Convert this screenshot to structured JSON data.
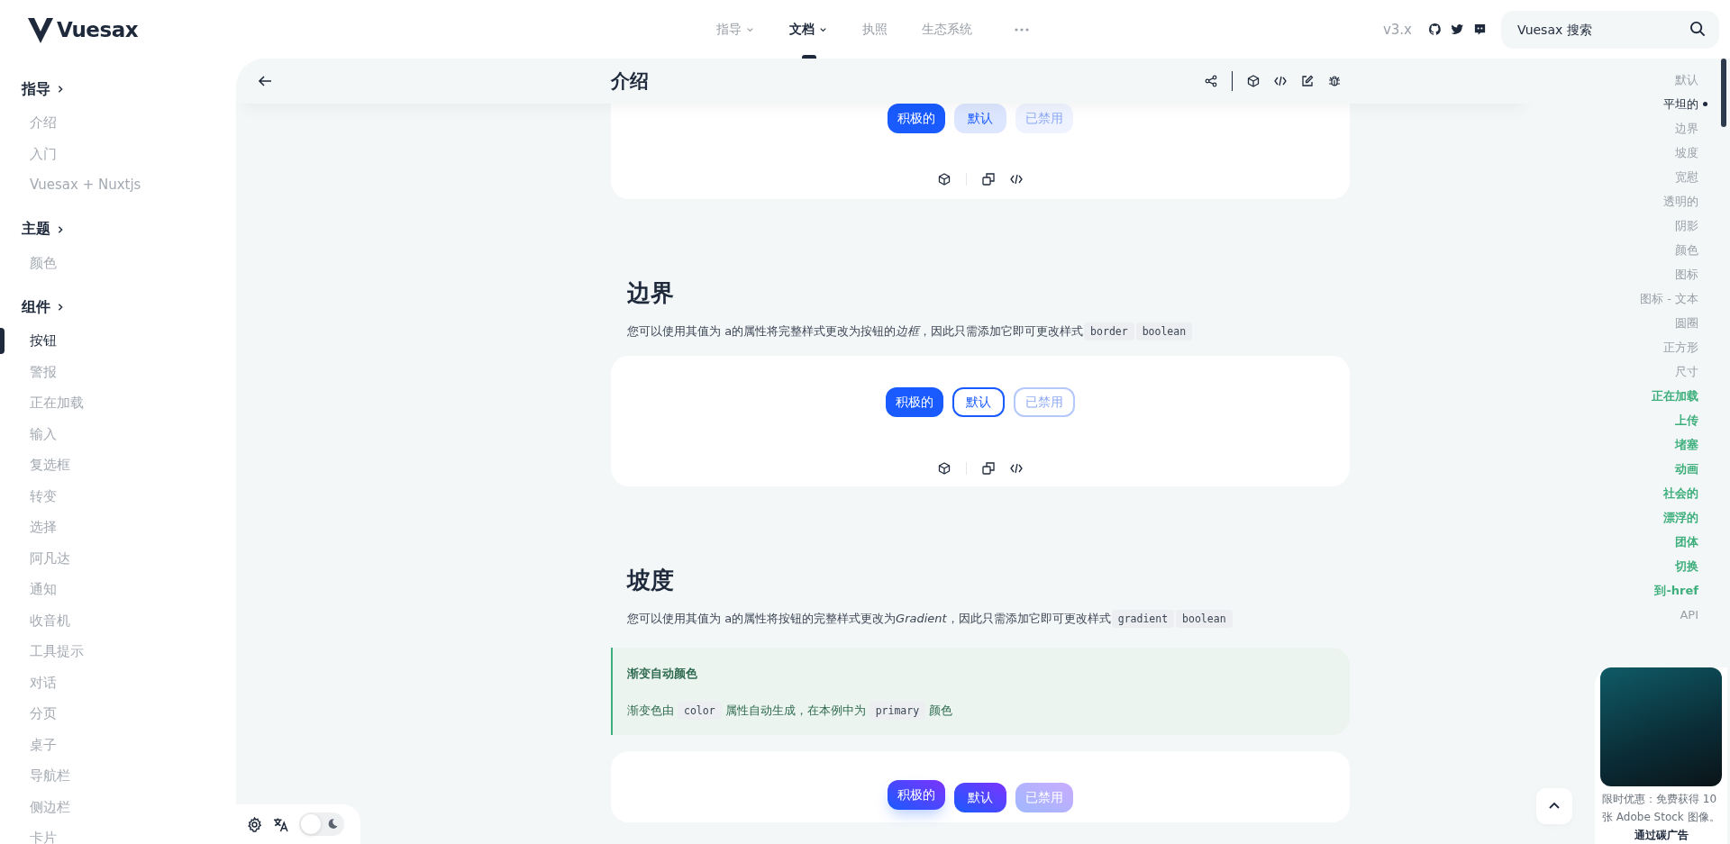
{
  "header": {
    "logo": "Vuesax",
    "nav": [
      {
        "label": "指导",
        "dropdown": true,
        "selected": false
      },
      {
        "label": "文档",
        "dropdown": true,
        "selected": true
      },
      {
        "label": "执照",
        "dropdown": false,
        "selected": false
      },
      {
        "label": "生态系统",
        "dropdown": false,
        "selected": false
      }
    ],
    "version": "v3.x",
    "search": {
      "placeholder": "Vuesax 搜索"
    }
  },
  "sidebar": {
    "sections": [
      {
        "title": "指导",
        "items": [
          {
            "label": "介绍",
            "selected": false
          },
          {
            "label": "入门",
            "selected": false
          },
          {
            "label": "Vuesax + Nuxtjs",
            "selected": false
          }
        ]
      },
      {
        "title": "主题",
        "items": [
          {
            "label": "颜色",
            "selected": false
          }
        ]
      },
      {
        "title": "组件",
        "items": [
          {
            "label": "按钮",
            "selected": true
          },
          {
            "label": "警报",
            "selected": false
          },
          {
            "label": "正在加载",
            "selected": false
          },
          {
            "label": "输入",
            "selected": false
          },
          {
            "label": "复选框",
            "selected": false
          },
          {
            "label": "转变",
            "selected": false
          },
          {
            "label": "选择",
            "selected": false
          },
          {
            "label": "阿凡达",
            "selected": false
          },
          {
            "label": "通知",
            "selected": false
          },
          {
            "label": "收音机",
            "selected": false
          },
          {
            "label": "工具提示",
            "selected": false
          },
          {
            "label": "对话",
            "selected": false
          },
          {
            "label": "分页",
            "selected": false
          },
          {
            "label": "桌子",
            "selected": false
          },
          {
            "label": "导航栏",
            "selected": false
          },
          {
            "label": "侧边栏",
            "selected": false
          },
          {
            "label": "卡片",
            "selected": false
          }
        ]
      }
    ]
  },
  "page": {
    "title": "介绍",
    "sections": [
      {
        "demo": {
          "kind": "flat",
          "toolbar": true,
          "buttons": [
            {
              "label": "积极的",
              "active": true,
              "disabled": false
            },
            {
              "label": "默认",
              "active": false,
              "disabled": false
            },
            {
              "label": "已禁用",
              "active": false,
              "disabled": true
            }
          ]
        }
      },
      {
        "heading": "边界",
        "description": [
          {
            "kind": "text",
            "text": "您可以使用其值为 a的属性将完整样式更改为按钮的"
          },
          {
            "kind": "em",
            "text": "边框"
          },
          {
            "kind": "text",
            "text": "，因此只需添加它即可更改样式"
          },
          {
            "kind": "code",
            "text": "border"
          },
          {
            "kind": "code",
            "text": "boolean"
          }
        ],
        "demo": {
          "kind": "border",
          "toolbar": true,
          "buttons": [
            {
              "label": "积极的",
              "active": true,
              "disabled": false
            },
            {
              "label": "默认",
              "active": false,
              "disabled": false
            },
            {
              "label": "已禁用",
              "active": false,
              "disabled": true
            }
          ]
        }
      },
      {
        "heading": "坡度",
        "description": [
          {
            "kind": "text",
            "text": "您可以使用其值为 a的属性将按钮的完整样式更改为"
          },
          {
            "kind": "em",
            "text": "Gradient"
          },
          {
            "kind": "text",
            "text": "，因此只需添加它即可更改样式"
          },
          {
            "kind": "code",
            "text": "gradient"
          },
          {
            "kind": "code",
            "text": "boolean"
          }
        ],
        "note": {
          "title": "渐变自动颜色",
          "text": [
            {
              "kind": "text",
              "text": "渐变色由"
            },
            {
              "kind": "code",
              "text": "color"
            },
            {
              "kind": "text",
              "text": "属性自动生成，在本例中为"
            },
            {
              "kind": "code",
              "text": "primary"
            },
            {
              "kind": "text",
              "text": "颜色"
            }
          ]
        },
        "demo": {
          "kind": "gradient",
          "toolbar": false,
          "buttons": [
            {
              "label": "积极的",
              "active": true,
              "disabled": false
            },
            {
              "label": "默认",
              "active": false,
              "disabled": false
            },
            {
              "label": "已禁用",
              "active": false,
              "disabled": true
            }
          ]
        }
      }
    ]
  },
  "toc": {
    "items": [
      {
        "label": "默认",
        "selected": false,
        "kind": "normal"
      },
      {
        "label": "平坦的",
        "selected": true,
        "kind": "normal"
      },
      {
        "label": "边界",
        "selected": false,
        "kind": "normal"
      },
      {
        "label": "坡度",
        "selected": false,
        "kind": "normal"
      },
      {
        "label": "宽慰",
        "selected": false,
        "kind": "normal"
      },
      {
        "label": "透明的",
        "selected": false,
        "kind": "normal"
      },
      {
        "label": "阴影",
        "selected": false,
        "kind": "normal"
      },
      {
        "label": "颜色",
        "selected": false,
        "kind": "normal"
      },
      {
        "label": "图标",
        "selected": false,
        "kind": "normal"
      },
      {
        "label": "图标 - 文本",
        "selected": false,
        "kind": "normal"
      },
      {
        "label": "圆圈",
        "selected": false,
        "kind": "normal"
      },
      {
        "label": "正方形",
        "selected": false,
        "kind": "normal"
      },
      {
        "label": "尺寸",
        "selected": false,
        "kind": "normal"
      },
      {
        "label": "正在加载",
        "selected": false,
        "kind": "new"
      },
      {
        "label": "上传",
        "selected": false,
        "kind": "new"
      },
      {
        "label": "堵塞",
        "selected": false,
        "kind": "new"
      },
      {
        "label": "动画",
        "selected": false,
        "kind": "new"
      },
      {
        "label": "社会的",
        "selected": false,
        "kind": "new"
      },
      {
        "label": "漂浮的",
        "selected": false,
        "kind": "new"
      },
      {
        "label": "团体",
        "selected": false,
        "kind": "new"
      },
      {
        "label": "切换",
        "selected": false,
        "kind": "new"
      },
      {
        "label": "到-href",
        "selected": false,
        "kind": "new"
      },
      {
        "label": "API",
        "selected": false,
        "kind": "normal"
      }
    ]
  },
  "ad": {
    "text": "限时优惠：免费获得 10 张 Adobe Stock 图像。",
    "credit": "通过碳广告"
  },
  "settings": {
    "dark_mode": false
  }
}
